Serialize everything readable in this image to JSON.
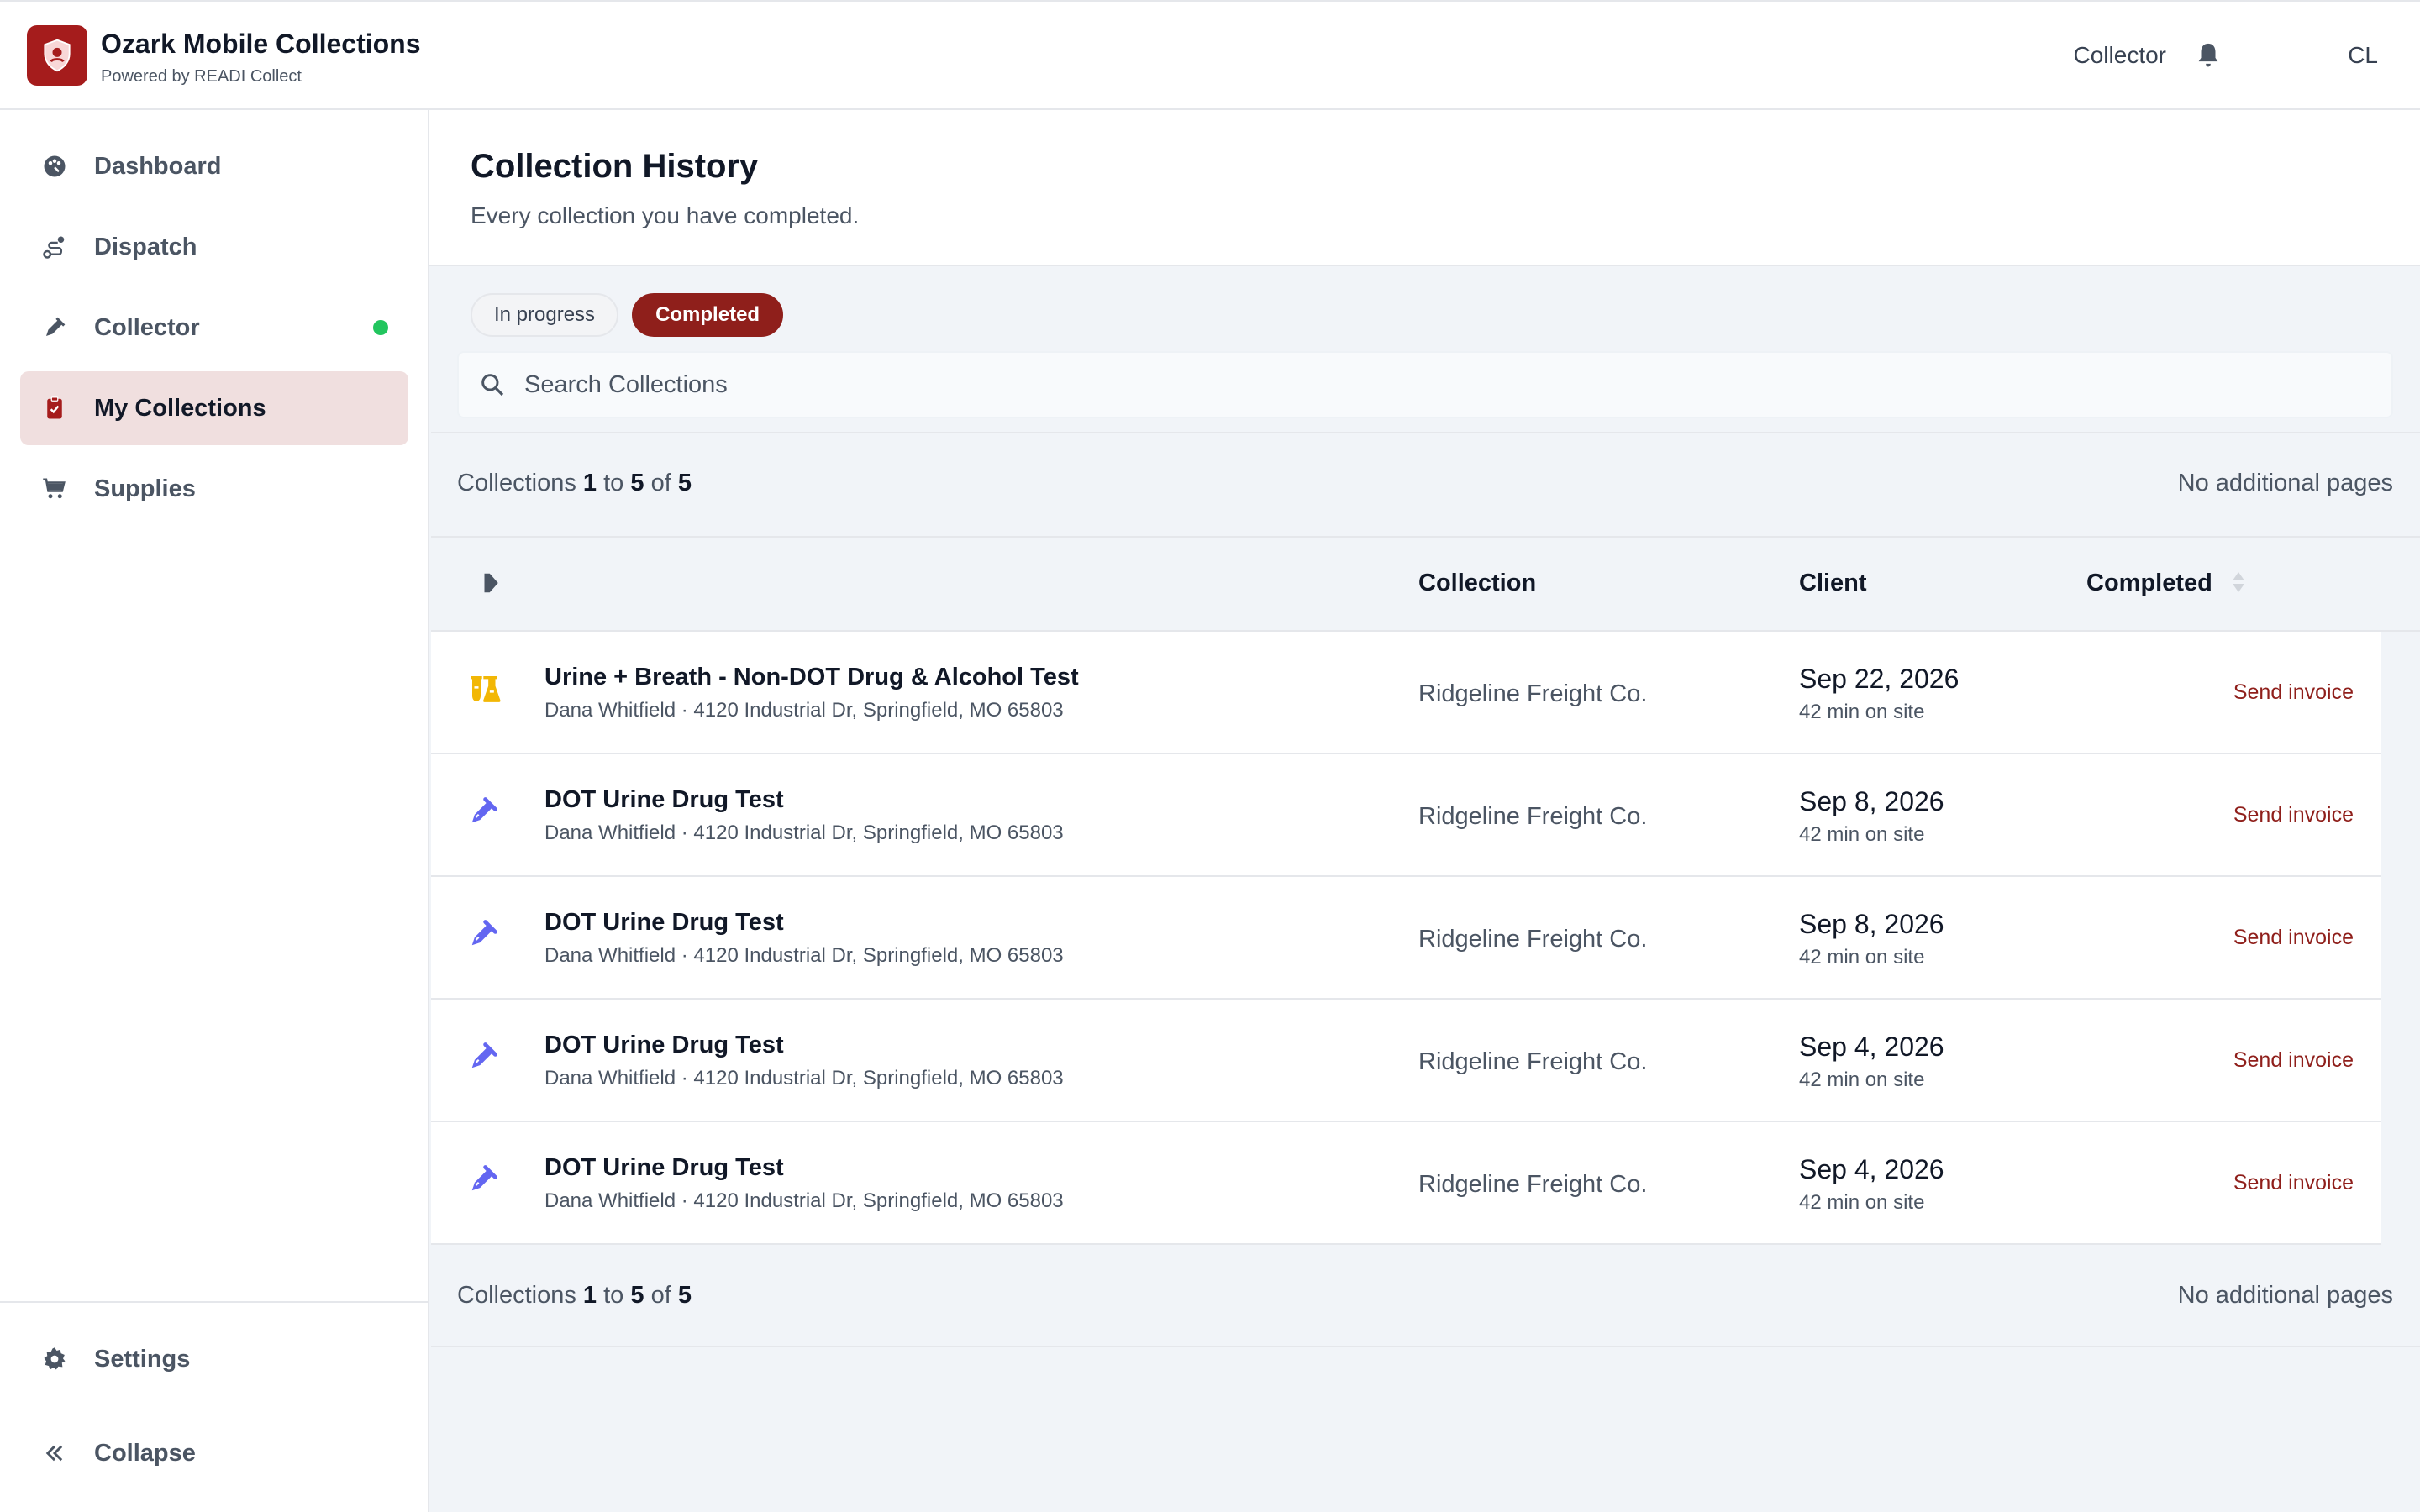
{
  "app": {
    "title": "Ozark Mobile Collections",
    "subtitle": "Powered by READI Collect",
    "role": "Collector",
    "avatar_initials": "CL",
    "accent": "#8f1f1b",
    "logo_bg": "#a51c1c"
  },
  "sidebar": {
    "items": [
      {
        "label": "Dashboard",
        "icon": "palette-icon"
      },
      {
        "label": "Dispatch",
        "icon": "route-icon"
      },
      {
        "label": "Collector",
        "icon": "pipette-icon",
        "status": "online",
        "status_color": "#22c55e"
      },
      {
        "label": "My Collections",
        "icon": "clipboard-check-icon",
        "active": true
      },
      {
        "label": "Supplies",
        "icon": "cart-icon"
      }
    ],
    "footer": [
      {
        "label": "Settings",
        "icon": "gear-icon"
      },
      {
        "label": "Collapse",
        "icon": "double-chevron-left-icon"
      }
    ]
  },
  "page": {
    "title": "Collection History",
    "subtitle": "Every collection you have completed."
  },
  "tabs": [
    {
      "label": "In progress",
      "active": false
    },
    {
      "label": "Completed",
      "active": true
    }
  ],
  "search": {
    "placeholder": "Search Collections",
    "value": ""
  },
  "pagination": {
    "prefix": "Collections",
    "from": "1",
    "to_word": "to",
    "to": "5",
    "of_word": "of",
    "total": "5",
    "right": "No additional pages"
  },
  "table": {
    "columns": [
      "Collection",
      "Client",
      "Completed"
    ],
    "rows": [
      {
        "icon": "flask-icon",
        "title": "Urine + Breath - Non-DOT Drug & Alcohol Test",
        "subtitle": "Dana Whitfield · 4120 Industrial Dr, Springfield, MO 65803",
        "client": "Ridgeline Freight Co.",
        "date": "Sep 22, 2026",
        "duration": "42 min on site",
        "action": "Send invoice"
      },
      {
        "icon": "pipette-icon",
        "title": "DOT Urine Drug Test",
        "subtitle": "Dana Whitfield · 4120 Industrial Dr, Springfield, MO 65803",
        "client": "Ridgeline Freight Co.",
        "date": "Sep 8, 2026",
        "duration": "42 min on site",
        "action": "Send invoice"
      },
      {
        "icon": "pipette-icon",
        "title": "DOT Urine Drug Test",
        "subtitle": "Dana Whitfield · 4120 Industrial Dr, Springfield, MO 65803",
        "client": "Ridgeline Freight Co.",
        "date": "Sep 8, 2026",
        "duration": "42 min on site",
        "action": "Send invoice"
      },
      {
        "icon": "pipette-icon",
        "title": "DOT Urine Drug Test",
        "subtitle": "Dana Whitfield · 4120 Industrial Dr, Springfield, MO 65803",
        "client": "Ridgeline Freight Co.",
        "date": "Sep 4, 2026",
        "duration": "42 min on site",
        "action": "Send invoice"
      },
      {
        "icon": "pipette-icon",
        "title": "DOT Urine Drug Test",
        "subtitle": "Dana Whitfield · 4120 Industrial Dr, Springfield, MO 65803",
        "client": "Ridgeline Freight Co.",
        "date": "Sep 4, 2026",
        "duration": "42 min on site",
        "action": "Send invoice"
      }
    ]
  }
}
